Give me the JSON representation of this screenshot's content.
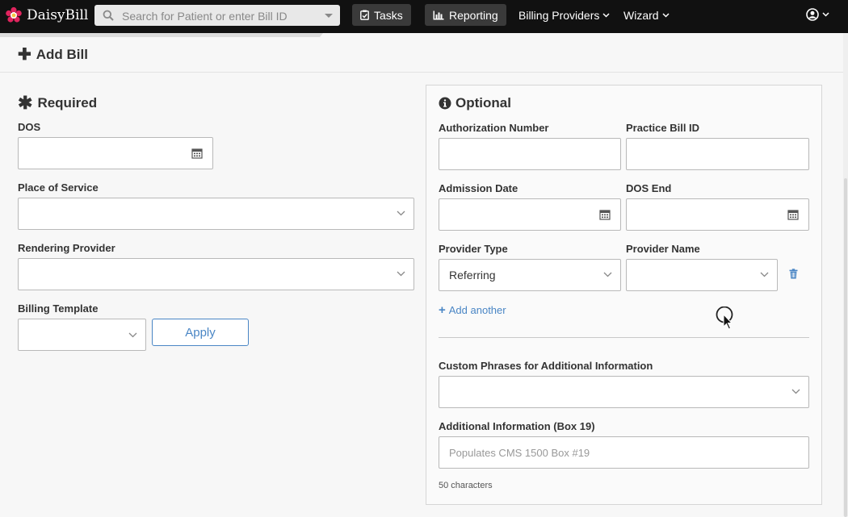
{
  "brand": {
    "name": "DaisyBill"
  },
  "search": {
    "placeholder": "Search for Patient or enter Bill ID"
  },
  "nav": {
    "tasks_label": "Tasks",
    "reporting_label": "Reporting",
    "billing_providers_label": "Billing Providers",
    "wizard_label": "Wizard"
  },
  "page": {
    "title": "Add Bill"
  },
  "required": {
    "title": "Required",
    "dos_label": "DOS",
    "place_of_service_label": "Place of Service",
    "rendering_provider_label": "Rendering Provider",
    "billing_template_label": "Billing Template",
    "apply_label": "Apply"
  },
  "optional": {
    "title": "Optional",
    "authorization_number_label": "Authorization Number",
    "practice_bill_id_label": "Practice Bill ID",
    "admission_date_label": "Admission Date",
    "dos_end_label": "DOS End",
    "provider_type_label": "Provider Type",
    "provider_type_value": "Referring",
    "provider_name_label": "Provider Name",
    "add_another_label": "Add another",
    "custom_phrases_label": "Custom Phrases for Additional Information",
    "additional_info_label": "Additional Information (Box 19)",
    "additional_info_placeholder": "Populates CMS 1500 Box #19",
    "char_count": "50 characters"
  },
  "colors": {
    "navbar": "#111111",
    "accent": "#4a86c5",
    "brand_flower": "#e0245e"
  }
}
